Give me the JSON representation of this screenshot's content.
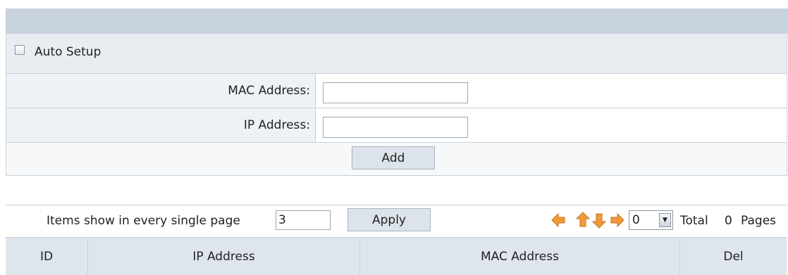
{
  "form": {
    "auto_setup_label": "Auto Setup",
    "auto_setup_checked": false,
    "mac_label": "MAC Address:",
    "mac_value": "",
    "ip_label": "IP Address:",
    "ip_value": "",
    "add_label": "Add"
  },
  "pager": {
    "items_label": "Items show in every single page",
    "items_value": "3",
    "apply_label": "Apply",
    "page_select_value": "0",
    "total_label": "Total",
    "total_count": "0",
    "pages_label": "Pages",
    "icons": [
      "first-page-icon",
      "previous-page-icon",
      "next-page-icon",
      "last-page-icon"
    ]
  },
  "table": {
    "columns": [
      "ID",
      "IP Address",
      "MAC Address",
      "Del"
    ]
  },
  "colors": {
    "header_bar": "#c9d3df",
    "nav_icon": "#f29a3a"
  }
}
